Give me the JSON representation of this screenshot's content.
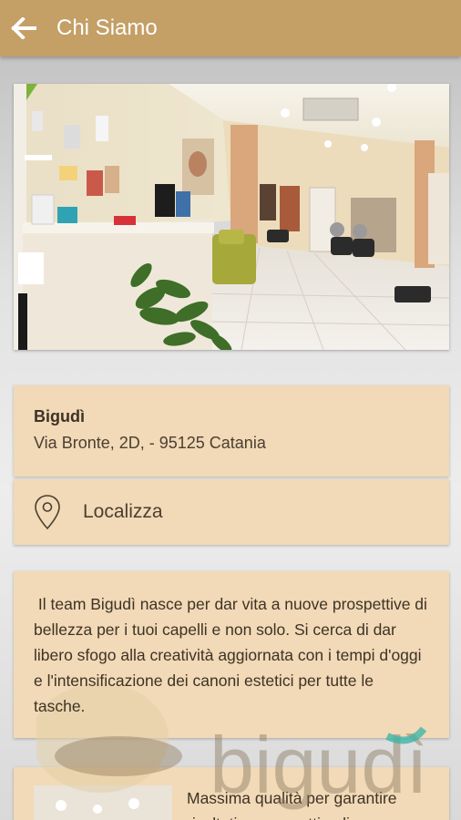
{
  "appbar": {
    "title": "Chi Siamo",
    "back_icon": "arrow-left-icon",
    "background": "#c49f66"
  },
  "business": {
    "name": "Bigudì",
    "address": "Via Bronte, 2D, - 95125 Catania"
  },
  "locate": {
    "icon": "map-pin-icon",
    "label": "Localizza"
  },
  "description": {
    "text": " Il team Bigudì nasce per dar vita a nuove prospettive di bellezza per i tuoi capelli e non solo. Si cerca di dar libero sfogo alla creatività aggiornata con i tempi d'oggi e l'intensificazione dei canoni estetici per tutte le tasche."
  },
  "watermark": {
    "logo_text": "bigudì"
  },
  "feature": {
    "text": "Massima qualità per garantire risultati sempre ottimali e"
  },
  "colors": {
    "card": "#f2d9b7",
    "text": "#3d3325",
    "accent_teal": "#3fb6a8"
  }
}
